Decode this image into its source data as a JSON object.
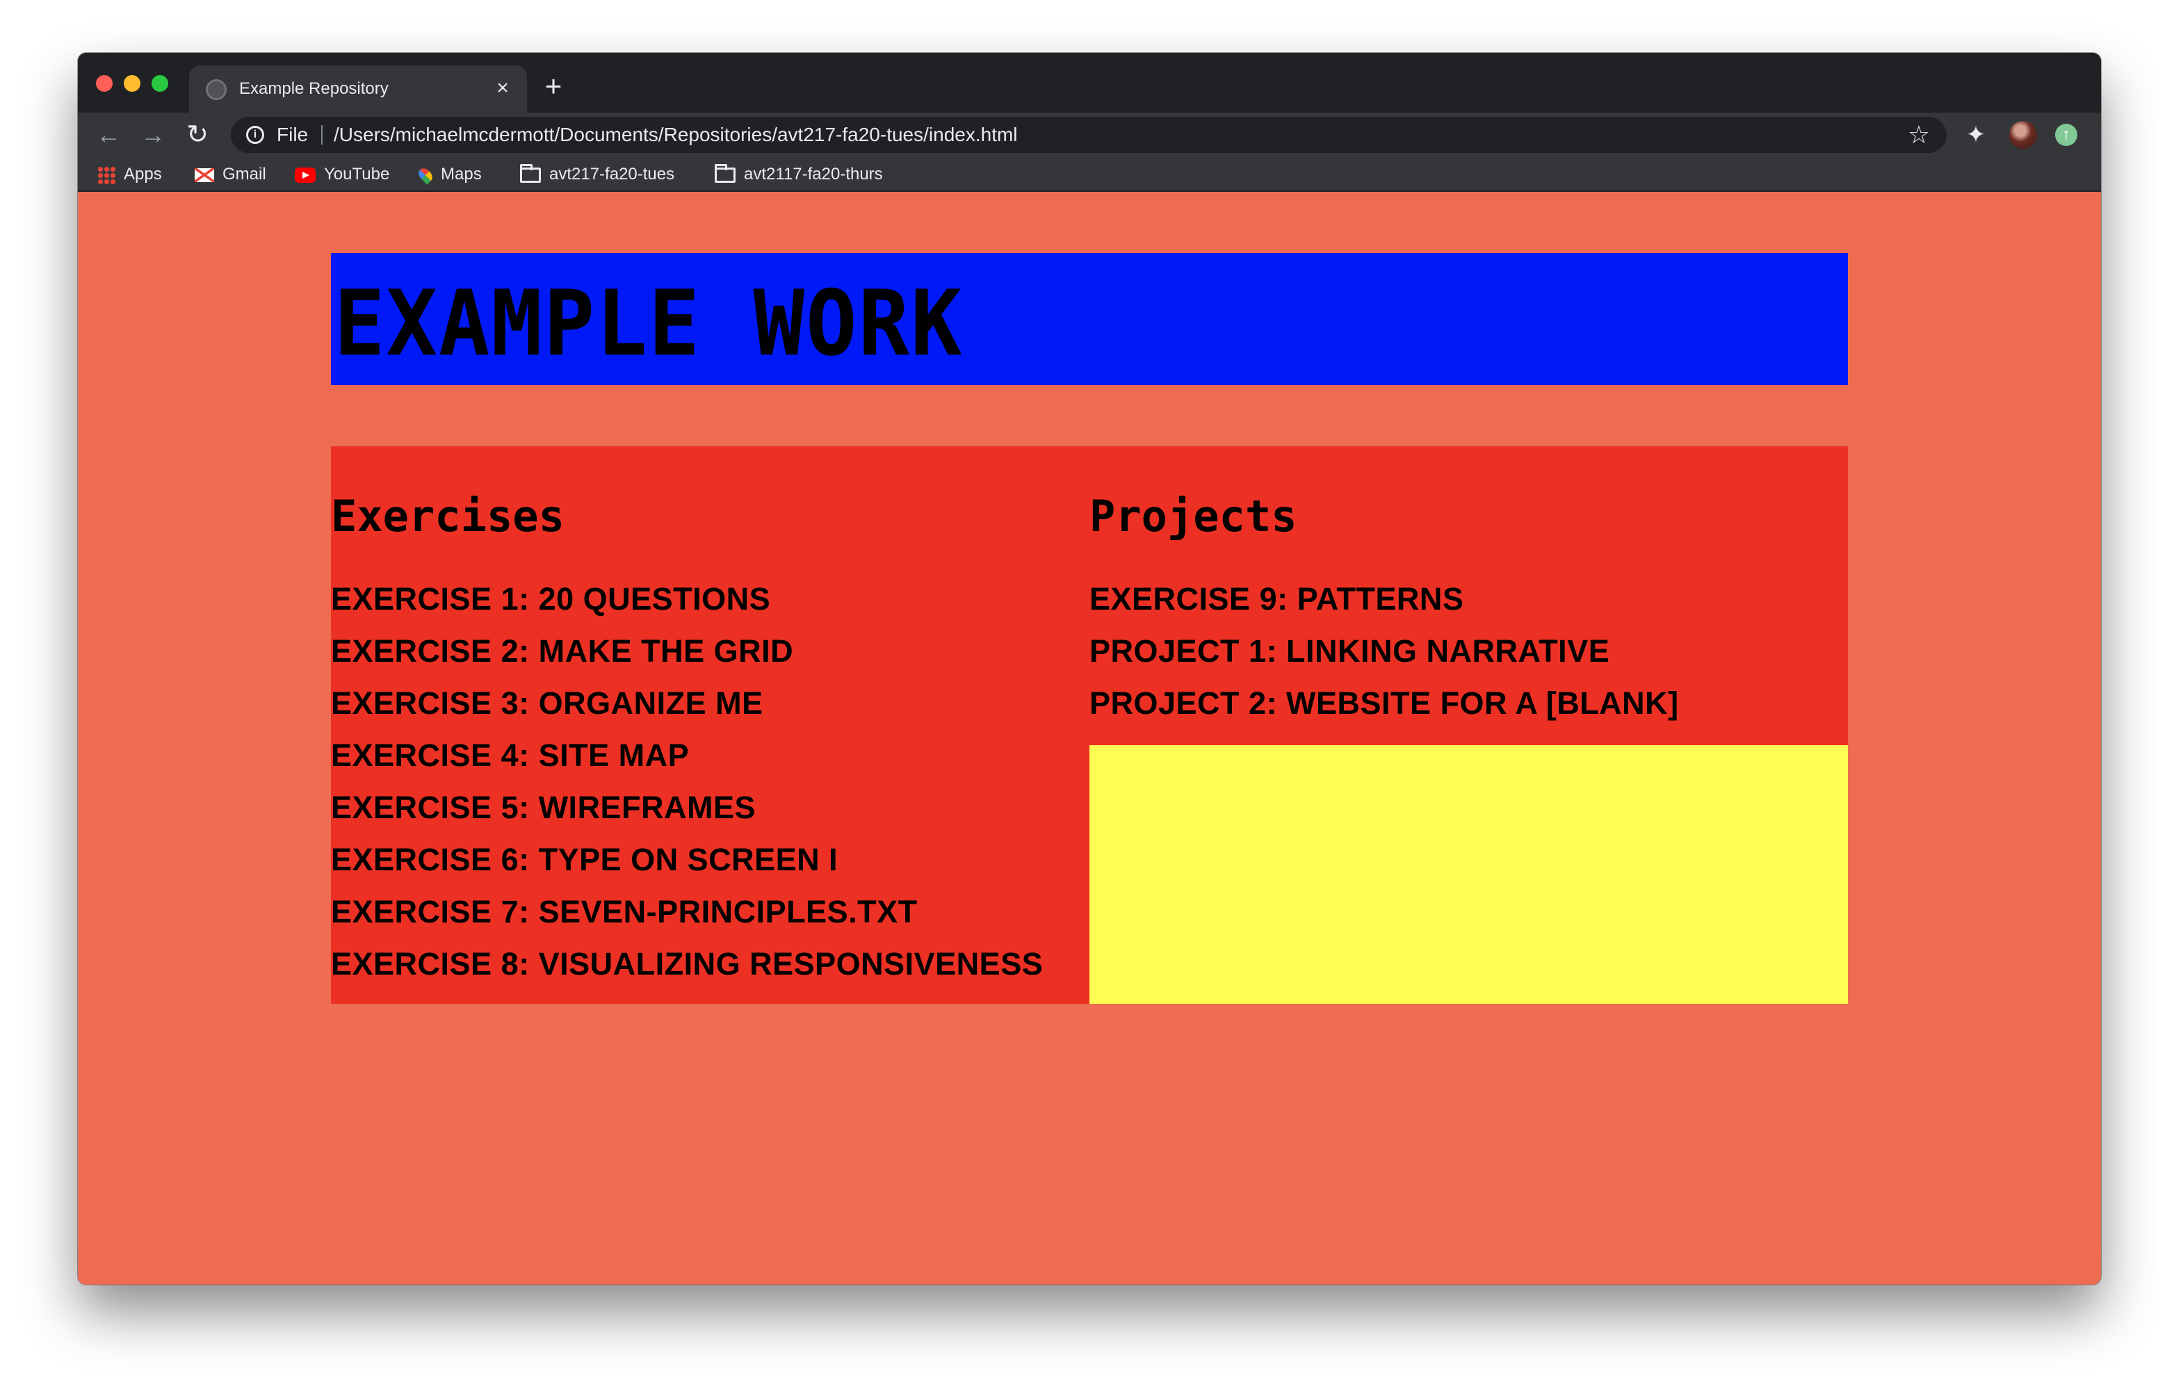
{
  "browser": {
    "tab_title": "Example Repository",
    "tab_close": "×",
    "new_tab": "+",
    "address_scheme": "File",
    "address_url": "/Users/michaelmcdermott/Documents/Repositories/avt217-fa20-tues/index.html",
    "icons": {
      "back": "back-arrow-icon",
      "forward": "forward-arrow-icon",
      "reload": "reload-icon",
      "info": "info-icon",
      "star": "star-icon",
      "extensions": "puzzle-icon",
      "profile": "avatar",
      "update": "update-arrow-icon"
    },
    "bookmarks": [
      {
        "label": "Apps",
        "icon": "apps-grid-icon"
      },
      {
        "label": "Gmail",
        "icon": "gmail-icon"
      },
      {
        "label": "YouTube",
        "icon": "youtube-icon"
      },
      {
        "label": "Maps",
        "icon": "maps-pin-icon"
      },
      {
        "label": "avt217-fa20-tues",
        "icon": "folder-icon"
      },
      {
        "label": "avt2117-fa20-thurs",
        "icon": "folder-icon"
      }
    ]
  },
  "page": {
    "title": "EXAMPLE WORK",
    "colors": {
      "background": "#ee6d52",
      "hero": "#0019f9",
      "panel": "#ec3124",
      "filler": "#fffc54"
    },
    "exercises": {
      "heading": "Exercises",
      "items": [
        "EXERCISE 1: 20 QUESTIONS",
        "EXERCISE 2: MAKE THE GRID",
        "EXERCISE 3: ORGANIZE ME",
        "EXERCISE 4: SITE MAP",
        "EXERCISE 5: WIREFRAMES",
        "EXERCISE 6: TYPE ON SCREEN I",
        "EXERCISE 7: SEVEN-PRINCIPLES.TXT",
        "EXERCISE 8: VISUALIZING RESPONSIVENESS"
      ]
    },
    "projects": {
      "heading": "Projects",
      "items": [
        "EXERCISE 9: PATTERNS",
        "PROJECT 1: LINKING NARRATIVE",
        "PROJECT 2: WEBSITE FOR A [BLANK]"
      ]
    }
  }
}
